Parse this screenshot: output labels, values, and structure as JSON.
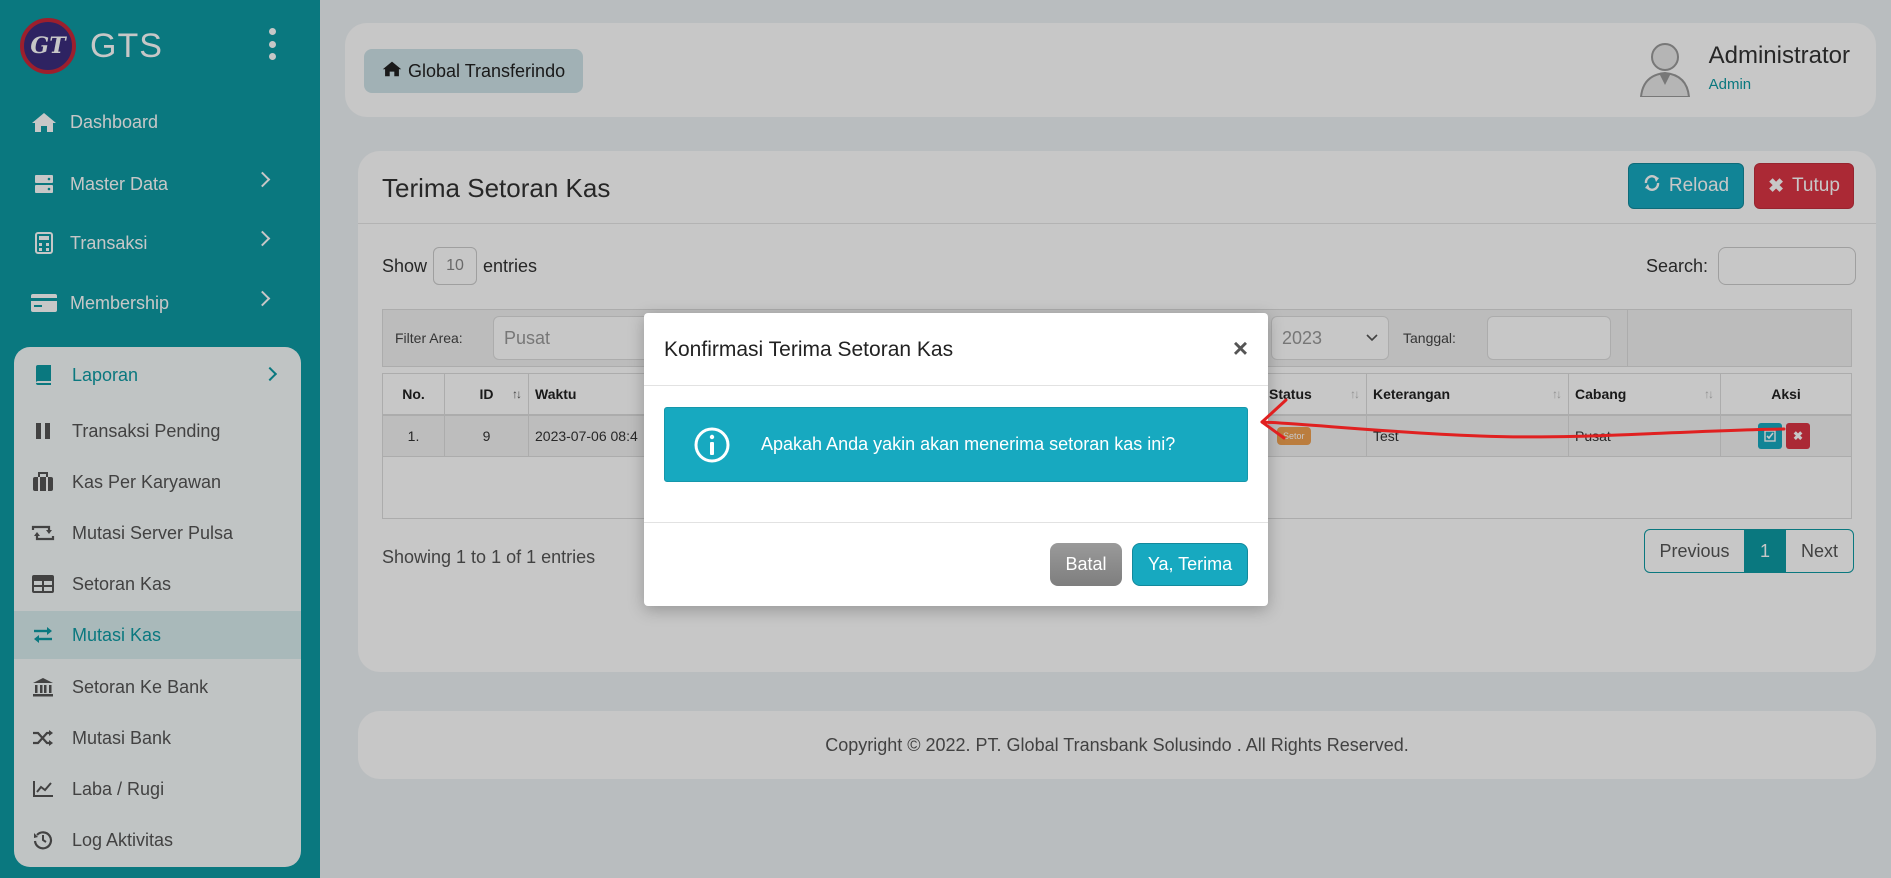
{
  "sidebar": {
    "brand": "GTS",
    "logo_text": "GT",
    "nav": [
      {
        "label": "Dashboard",
        "icon": "home-icon"
      },
      {
        "label": "Master Data",
        "icon": "server-icon"
      },
      {
        "label": "Transaksi",
        "icon": "calculator-icon"
      },
      {
        "label": "Membership",
        "icon": "card-icon"
      }
    ],
    "laporan": {
      "label": "Laporan",
      "items": [
        {
          "label": "Transaksi Pending",
          "icon": "pause-icon"
        },
        {
          "label": "Kas Per Karyawan",
          "icon": "briefcase-icon"
        },
        {
          "label": "Mutasi Server Pulsa",
          "icon": "retweet-icon"
        },
        {
          "label": "Setoran Kas",
          "icon": "table-icon"
        },
        {
          "label": "Mutasi Kas",
          "icon": "exchange-icon",
          "active": true
        },
        {
          "label": "Setoran Ke Bank",
          "icon": "bank-icon"
        },
        {
          "label": "Mutasi Bank",
          "icon": "random-icon"
        },
        {
          "label": "Laba / Rugi",
          "icon": "line-chart-icon"
        },
        {
          "label": "Log Aktivitas",
          "icon": "history-icon"
        }
      ]
    }
  },
  "topbar": {
    "home_label": "Global Transferindo",
    "user_name": "Administrator",
    "user_role": "Admin"
  },
  "card": {
    "title": "Terima Setoran Kas",
    "reload_label": "Reload",
    "tutup_label": "Tutup",
    "show_label": "Show",
    "entries_label": "entries",
    "page_size": "10",
    "search_label": "Search:",
    "filter": {
      "area_label": "Filter Area:",
      "area_value": "Pusat",
      "year_value": "2023",
      "tanggal_label": "Tanggal:"
    },
    "columns": [
      "No.",
      "ID",
      "Waktu",
      "Status",
      "Keterangan",
      "Cabang",
      "Aksi"
    ],
    "row": {
      "no": "1.",
      "id": "9",
      "waktu": "2023-07-06 08:4",
      "status": "Setor",
      "keterangan": "Test",
      "cabang": "Pusat"
    },
    "showing": "Showing 1 to 1 of 1 entries",
    "pager": {
      "prev": "Previous",
      "current": "1",
      "next": "Next"
    }
  },
  "footer": "Copyright © 2022. PT. Global Transbank Solusindo . All Rights Reserved.",
  "modal": {
    "title": "Konfirmasi Terima Setoran Kas",
    "close": "×",
    "message": "Apakah Anda yakin akan menerima setoran kas ini?",
    "cancel": "Batal",
    "confirm": "Ya, Terima"
  },
  "colors": {
    "primary": "#0d9aa3",
    "info": "#17a9c0",
    "danger": "#dc3545",
    "annotation": "#e02020"
  }
}
